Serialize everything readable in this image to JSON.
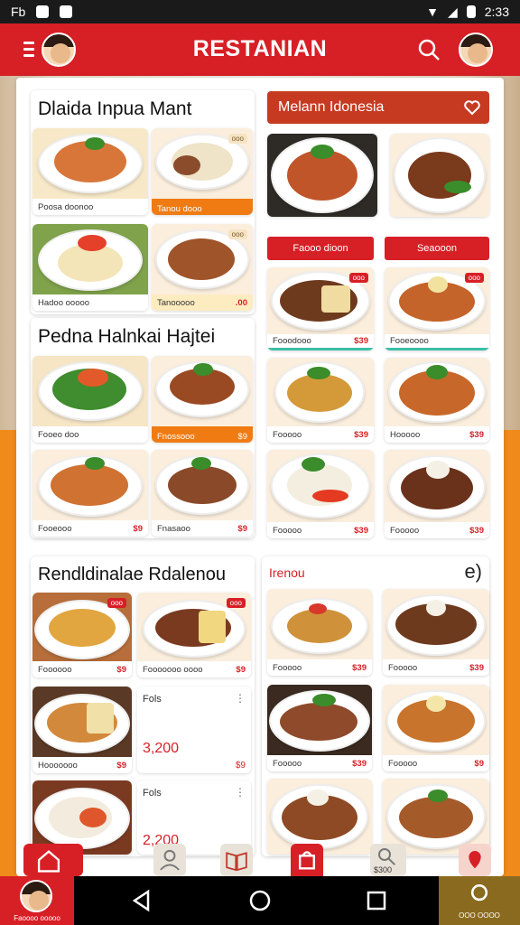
{
  "status_bar": {
    "left_text": "Fb",
    "time": "2:33"
  },
  "app_bar": {
    "title": "RESTANIAN"
  },
  "section1": {
    "title": "Dlaida Inpua Mant",
    "tiles": [
      {
        "caption": "Poosa doonoo",
        "price": "",
        "tag": ""
      },
      {
        "caption": "Tanou dooo",
        "price": "",
        "tag": "ooo"
      },
      {
        "caption": "Hadoo ooooo",
        "price": "",
        "tag": "ooo"
      },
      {
        "caption": "Tanooooo",
        "price": ".00",
        "tag": ""
      }
    ]
  },
  "section2": {
    "title": "Pedna Halnkai Hajtei",
    "tiles": [
      {
        "caption": "Fooeo doo",
        "price": "",
        "tag": ""
      },
      {
        "caption": "Fnossooo",
        "price": "$9",
        "tag": ""
      },
      {
        "caption": "Fooeooo",
        "price": "$9",
        "tag": ""
      },
      {
        "caption": "Fnasaoo",
        "price": "$9",
        "tag": ""
      }
    ]
  },
  "section3": {
    "banner": "Melann Idonesia",
    "buttons": [
      "Faooo dioon",
      "Seaooon"
    ],
    "tiles": [
      {
        "caption": "",
        "price": "",
        "tag": ""
      },
      {
        "caption": "",
        "price": "",
        "tag": ""
      },
      {
        "caption": "Fooodooo",
        "price": "$39",
        "tag": "ooo"
      },
      {
        "caption": "Fooeoooo",
        "price": "",
        "tag": "ooo"
      },
      {
        "caption": "Fooooo",
        "price": "$39",
        "tag": ""
      },
      {
        "caption": "Hooooo",
        "price": "$39",
        "tag": ""
      },
      {
        "caption": "Fooooo",
        "price": "$39",
        "tag": ""
      },
      {
        "caption": "Fooooo",
        "price": "$39",
        "tag": ""
      }
    ]
  },
  "section4": {
    "title": "Rendldinalae Rdalenou",
    "tiles": [
      {
        "caption": "Foooooo",
        "price": "$9",
        "tag": "ooo"
      },
      {
        "caption": "Fooooooo oooo",
        "price": "$9",
        "tag": "ooo"
      },
      {
        "caption": "Hooooooo",
        "price": "$9",
        "tag": ""
      }
    ],
    "details": [
      {
        "label": "Fols",
        "amount": "3,200",
        "price": "$9"
      },
      {
        "label": "Fols",
        "amount": "2,200",
        "price": ""
      }
    ]
  },
  "section5": {
    "title": "Irenou",
    "badge": "e)",
    "tiles": [
      {
        "caption": "Fooooo",
        "price": "$39",
        "tag": ""
      },
      {
        "caption": "Fooooo",
        "price": "$39",
        "tag": ""
      },
      {
        "caption": "Fooooo",
        "price": "$39",
        "tag": ""
      },
      {
        "caption": "Fooooo",
        "price": "$9",
        "tag": ""
      },
      {
        "caption": "",
        "price": "",
        "tag": ""
      },
      {
        "caption": "",
        "price": "",
        "tag": ""
      }
    ]
  },
  "bottom_actions": {
    "price": "$300"
  },
  "nav": {
    "left_caption": "Faoooo ooooo",
    "right_caption": "OOO OOOO"
  },
  "colors": {
    "brand_red": "#d71f26",
    "accent_orange": "#f07b12"
  }
}
